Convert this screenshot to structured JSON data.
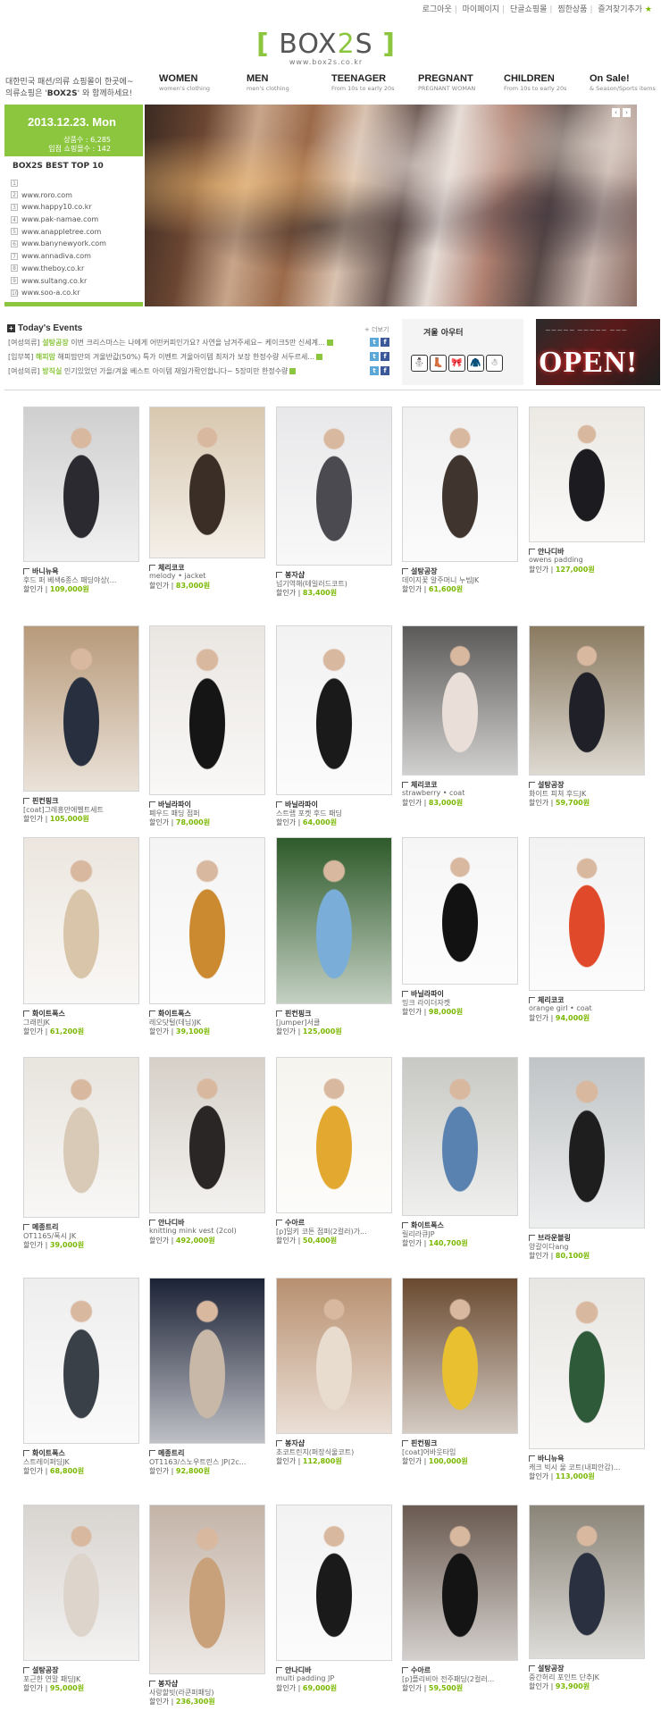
{
  "top_links": [
    "로그아웃",
    "마이페이지",
    "단골쇼핑몰",
    "찜한상품",
    "즐겨찾기추가"
  ],
  "logo": {
    "left": "[",
    "box": "BOX",
    "two": "2",
    "s": "S",
    "right": "]",
    "url": "www.box2s.co.kr"
  },
  "intro": {
    "line1": "대한민국 패션/의류 쇼핑몰이 한곳에~",
    "line2_pre": "의류쇼핑은 '",
    "brand": "BOX2S",
    "line2_post": "' 와 함께하세요!"
  },
  "nav": [
    {
      "title": "WOMEN",
      "sub": "women's clothing"
    },
    {
      "title": "MEN",
      "sub": "men's clothing"
    },
    {
      "title": "TEENAGER",
      "sub": "From 10s to early 20s"
    },
    {
      "title": "PREGNANT",
      "sub": "PREGNANT WOMAN"
    },
    {
      "title": "CHILDREN",
      "sub": "From 10s to early 20s"
    },
    {
      "title": "On Sale!",
      "sub": "& Season/Sports items"
    }
  ],
  "date_panel": {
    "date": "2013.12.23. Mon",
    "products": "상품수 : 6,285",
    "shops": "입점 쇼핑몰수 : 142"
  },
  "best": {
    "title": "BOX2S BEST TOP 10",
    "items": [
      "",
      "www.roro.com",
      "www.happy10.co.kr",
      "www.pak-namae.com",
      "www.anappletree.com",
      "www.banynewyork.com",
      "www.annadiva.com",
      "www.theboy.co.kr",
      "www.sultang.co.kr",
      "www.soo-a.co.kr"
    ]
  },
  "banner": {
    "prev": "‹",
    "next": "›"
  },
  "events": {
    "title": "Today's Events",
    "more": "+ 더보기",
    "rows": [
      {
        "tag": "[여성의류]",
        "shop": "설탕공장",
        "text": "이번 크리스마스는 나에게 어떤커피인가요? 사연을 남겨주세요~ 케이크5만 신세계..."
      },
      {
        "tag": "[임부복]",
        "shop": "해피맘",
        "text": "해피맘만의 겨울반값(50%) 특가 이벤트 겨울아이템 최저가 보장 한정수량 서두르세..."
      },
      {
        "tag": "[여성의류]",
        "shop": "방직실",
        "text": "인기있었던 가을/겨울 베스트 아이템 재일가확인합니다~ 5장미만 한정수량"
      }
    ]
  },
  "promo": {
    "winter_title": "겨울 아우터",
    "icons": [
      "⛄",
      "👢",
      "🎀",
      "🧥",
      "☃"
    ],
    "open_small": "~~~~~ ~~~~~ ~~~",
    "open": "OPEN!"
  },
  "products": [
    {
      "shop": "바니뉴욕",
      "name": "후드 퍼 베색6종스 패딩야상(...",
      "price": "109,000원"
    },
    {
      "shop": "체리코코",
      "name": "melody • jacket",
      "price": "83,000원"
    },
    {
      "shop": "봉자샵",
      "name": "넘기역해(테일러드코트)",
      "price": "83,400원"
    },
    {
      "shop": "설탕공장",
      "name": "데이지꽃 알주머니 누빔JK",
      "price": "61,600원"
    },
    {
      "shop": "안나디바",
      "name": "owens padding",
      "price": "127,000원"
    },
    {
      "shop": "핀컨핑크",
      "name": "[coat]그레흥만에벨트세트",
      "price": "105,000원"
    },
    {
      "shop": "바닐라파이",
      "name": "폐우드 패딩 점퍼",
      "price": "78,000원"
    },
    {
      "shop": "바닐라파이",
      "name": "스트랩 포켓 후드 패딩",
      "price": "64,000원"
    },
    {
      "shop": "체리코코",
      "name": "strawberry • coat",
      "price": "83,000원"
    },
    {
      "shop": "설탕공장",
      "name": "화이트 피쳐 후드JK",
      "price": "59,700원"
    },
    {
      "shop": "화이트폭스",
      "name": "그래핀JK",
      "price": "61,200원"
    },
    {
      "shop": "화이트폭스",
      "name": "레오닷털(데님)JK",
      "price": "39,100원"
    },
    {
      "shop": "핀컨핑크",
      "name": "[jumper]서클",
      "price": "125,000원"
    },
    {
      "shop": "바닐라파이",
      "name": "밍크 라이더자켓",
      "price": "98,000원"
    },
    {
      "shop": "체리코코",
      "name": "orange girl • coat",
      "price": "94,000원"
    },
    {
      "shop": "메종트리",
      "name": "OT1165/폭시 JK",
      "price": "39,000원"
    },
    {
      "shop": "안나디바",
      "name": "knitting mink vest (2col)",
      "price": "492,000원"
    },
    {
      "shop": "수아르",
      "name": "[p]밀키 코튼 점퍼(2컬러)가...",
      "price": "50,400원"
    },
    {
      "shop": "화이트폭스",
      "name": "릴리라큐JP",
      "price": "140,700원"
    },
    {
      "shop": "브라운블링",
      "name": "양갈이다ang",
      "price": "80,100원"
    },
    {
      "shop": "화이트폭스",
      "name": "스트레이퍼딩JK",
      "price": "68,800원"
    },
    {
      "shop": "메종트리",
      "name": "OT1163/스노우트린스 JP(2c...",
      "price": "92,800원"
    },
    {
      "shop": "봉자샵",
      "name": "초코트린지(퍼장식울코트)",
      "price": "112,800원"
    },
    {
      "shop": "핀컨핑크",
      "name": "[coat]어바웃타임",
      "price": "100,000원"
    },
    {
      "shop": "바니뉴욕",
      "name": "캐크 빅시 울 코트(내피안감)...",
      "price": "113,000원"
    },
    {
      "shop": "설탕공장",
      "name": "포근한 연말 패딩JK",
      "price": "95,000원"
    },
    {
      "shop": "봉자샵",
      "name": "사랑할빗(라쿤퍼패딩)",
      "price": "236,300원"
    },
    {
      "shop": "안나디바",
      "name": "multi padding JP",
      "price": "69,000원"
    },
    {
      "shop": "수아르",
      "name": "[p]플리비아 전주패딩(2컬러...",
      "price": "59,500원"
    },
    {
      "shop": "설탕공장",
      "name": "중간허리 포인트 단추JK",
      "price": "93,900원"
    }
  ],
  "price_label": "할인가 | "
}
